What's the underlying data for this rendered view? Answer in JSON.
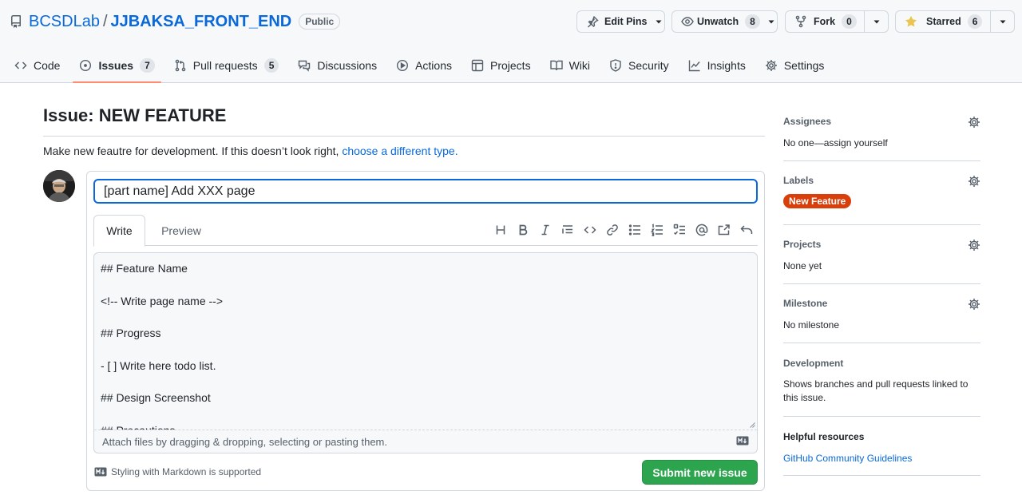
{
  "repo": {
    "owner": "BCSDLab",
    "separator": "/",
    "name": "JJBAKSA_FRONT_END",
    "visibility": "Public"
  },
  "actions": {
    "edit_pins": "Edit Pins",
    "unwatch": "Unwatch",
    "unwatch_count": "8",
    "fork": "Fork",
    "fork_count": "0",
    "starred": "Starred",
    "star_count": "6"
  },
  "nav": {
    "code": "Code",
    "issues": "Issues",
    "issues_count": "7",
    "pulls": "Pull requests",
    "pulls_count": "5",
    "discussions": "Discussions",
    "actions": "Actions",
    "projects": "Projects",
    "wiki": "Wiki",
    "security": "Security",
    "insights": "Insights",
    "settings": "Settings"
  },
  "issue": {
    "heading": "Issue: NEW FEATURE",
    "description": "Make new feautre for development. If this doesn’t look right, ",
    "description_link": "choose a different type.",
    "title_value": "[part name] Add XXX page",
    "tab_write": "Write",
    "tab_preview": "Preview",
    "body": "## Feature Name\n\n<!-- Write page name -->\n\n## Progress\n\n- [ ] Write here todo list.\n\n## Design Screenshot\n\n## Precautions",
    "attach_hint": "Attach files by dragging & dropping, selecting or pasting them.",
    "markdown_note": "Styling with Markdown is supported",
    "submit": "Submit new issue"
  },
  "toolbar_icons": [
    "heading-icon",
    "bold-icon",
    "italic-icon",
    "quote-icon",
    "code-icon",
    "link-icon",
    "unordered-list-icon",
    "ordered-list-icon",
    "task-list-icon",
    "mention-icon",
    "reference-icon",
    "undo-icon"
  ],
  "sidebar": {
    "assignees_label": "Assignees",
    "assignees_value": "No one—assign yourself",
    "labels_label": "Labels",
    "label_name": "New Feature",
    "label_color": "#d93f0b",
    "projects_label": "Projects",
    "projects_value": "None yet",
    "milestone_label": "Milestone",
    "milestone_value": "No milestone",
    "development_label": "Development",
    "development_value": "Shows branches and pull requests linked to this issue.",
    "helpful_label": "Helpful resources",
    "helpful_link": "GitHub Community Guidelines"
  },
  "colors": {
    "accent": "#0969da",
    "submit": "#2da44e",
    "tab_underline": "#fd8c73"
  }
}
